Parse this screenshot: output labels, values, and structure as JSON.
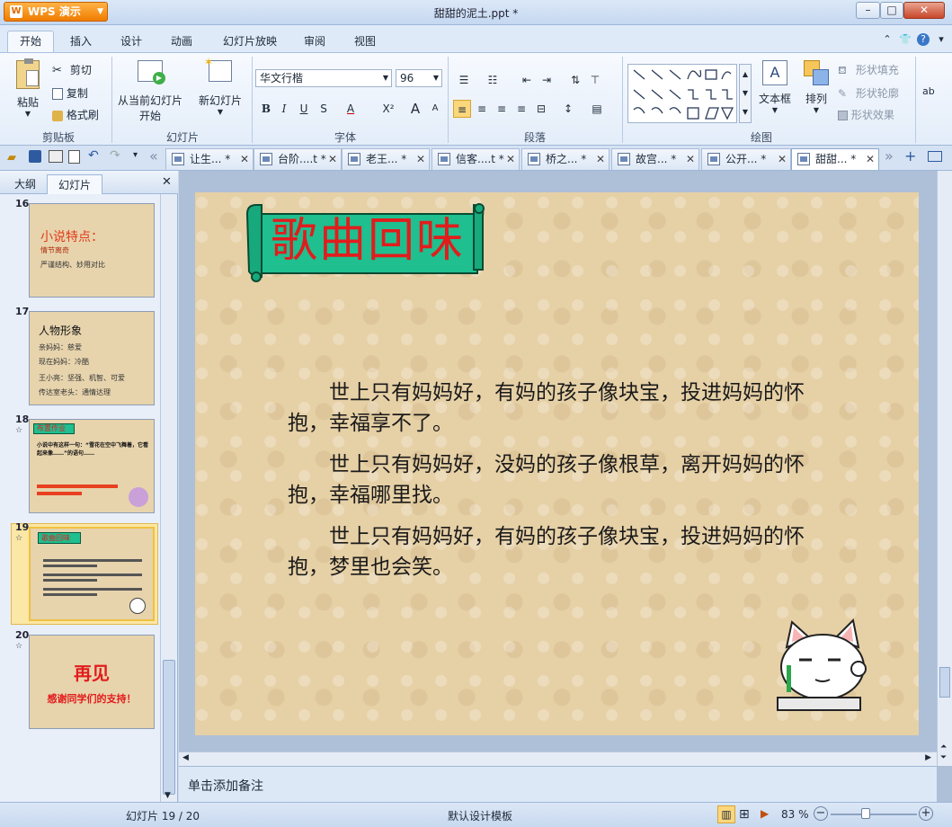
{
  "app": {
    "name": "WPS 演示",
    "window_title": "甜甜的泥土.ppt *"
  },
  "menu_tabs": [
    "开始",
    "插入",
    "设计",
    "动画",
    "幻灯片放映",
    "审阅",
    "视图"
  ],
  "ribbon": {
    "clipboard": {
      "paste": "粘贴",
      "cut": "剪切",
      "copy": "复制",
      "format_painter": "格式刷",
      "label": "剪贴板"
    },
    "slides": {
      "from_current_1": "从当前幻灯片",
      "from_current_2": "开始",
      "new_slide": "新幻灯片",
      "label": "幻灯片"
    },
    "font": {
      "name": "华文行楷",
      "size": "96",
      "bold": "B",
      "italic": "I",
      "underline": "U",
      "strike": "S",
      "color": "A",
      "superscript": "X²",
      "grow": "A",
      "shrink": "A",
      "label": "字体"
    },
    "paragraph": {
      "label": "段落"
    },
    "drawing": {
      "textbox": "文本框",
      "arrange": "排列",
      "fill": "形状填充",
      "outline": "形状轮廓",
      "effect": "形状效果",
      "label": "绘图"
    }
  },
  "doc_tabs": [
    "让生... *",
    "台阶....t *",
    "老王... *",
    "信客....t *",
    "桥之... *",
    "故宫... *",
    "公开... *",
    "甜甜... *"
  ],
  "panel": {
    "outline_tab": "大纲",
    "slides_tab": "幻灯片"
  },
  "thumbnails": [
    {
      "num": "16",
      "title": "小说特点：",
      "lines": [
        "情节离奇",
        "严谨结构、妙用对比"
      ]
    },
    {
      "num": "17",
      "title": "人物形象",
      "lines": [
        "亲妈妈：慈爱",
        "现在妈妈：冷酷",
        "王小亮：坚强、机智、可爱",
        "传达室老头：通情达理"
      ]
    },
    {
      "num": "18",
      "star": "☆",
      "title": "布置作业",
      "lines": [
        "小说中有这样一句：“雪花在空中飞舞着，它看起来像……”的语句……"
      ]
    },
    {
      "num": "19",
      "star": "☆",
      "title": "歌曲回味",
      "lines": [
        "世上只有妈妈好……"
      ]
    },
    {
      "num": "20",
      "star": "☆",
      "title": "再见",
      "subtitle": "感谢同学们的支持！"
    }
  ],
  "slide": {
    "title": "歌曲回味",
    "paragraphs": [
      "世上只有妈妈好，有妈的孩子像块宝，投进妈妈的怀抱，幸福享不了。",
      "世上只有妈妈好，没妈的孩子像根草，离开妈妈的怀抱，幸福哪里找。",
      "世上只有妈妈好，有妈的孩子像块宝，投进妈妈的怀抱，梦里也会笑。"
    ]
  },
  "notes_placeholder": "单击添加备注",
  "status": {
    "slide_counter": "幻灯片 19 / 20",
    "template": "默认设计模板",
    "zoom": "83 %"
  },
  "colors": {
    "title_red": "#e21c1c",
    "banner_green": "#1fbf8f",
    "ribbon_bg": "#e3edf9"
  }
}
